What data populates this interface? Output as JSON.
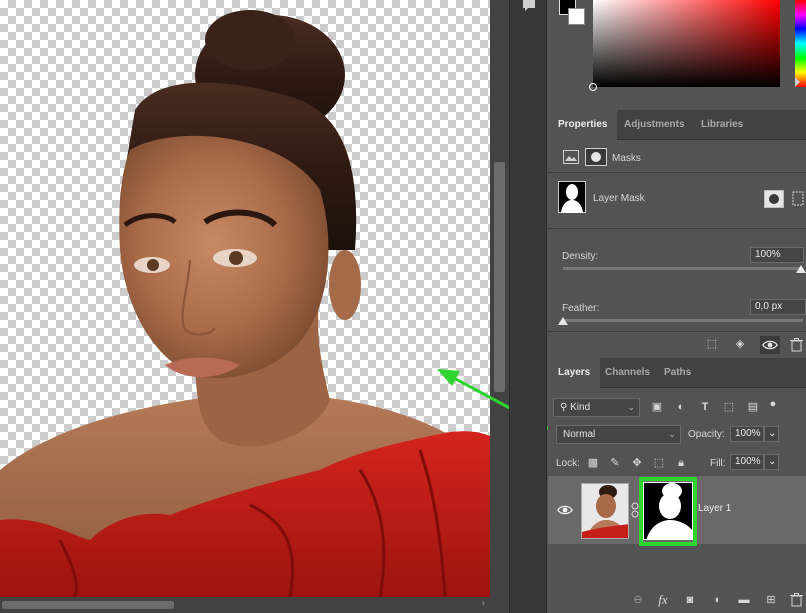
{
  "properties_panel": {
    "tabs": [
      {
        "label": "Properties",
        "active": true
      },
      {
        "label": "Adjustments",
        "active": false
      },
      {
        "label": "Libraries",
        "active": false
      }
    ],
    "masks_label": "Masks",
    "layer_mask_label": "Layer Mask",
    "density_label": "Density:",
    "density_value": "100%",
    "feather_label": "Feather:",
    "feather_value": "0,0 px"
  },
  "layers_panel": {
    "tabs": [
      {
        "label": "Layers",
        "active": true
      },
      {
        "label": "Channels",
        "active": false
      },
      {
        "label": "Paths",
        "active": false
      }
    ],
    "filter_value": "Kind",
    "blend_mode": "Normal",
    "opacity_label": "Opacity:",
    "opacity_value": "100%",
    "lock_label": "Lock:",
    "fill_label": "Fill:",
    "fill_value": "100%",
    "layer": {
      "name": "Layer 1",
      "visible": true
    }
  },
  "colors": {
    "annotation_green": "#2ed52e",
    "panel_bg": "#535353",
    "tab_bar_bg": "#424242"
  },
  "icons": [
    "comment-icon",
    "image-icon",
    "mask-icon",
    "eye-icon",
    "trash-icon",
    "selection-icon",
    "link-icon",
    "fx-icon",
    "folder-icon",
    "new-layer-icon",
    "adjustment-icon"
  ]
}
